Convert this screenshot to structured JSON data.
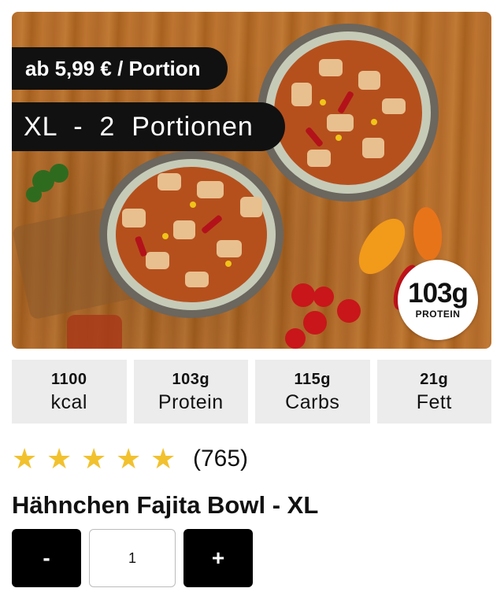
{
  "product": {
    "price_label": "ab 5,99 € / Portion",
    "size_label": "XL  -  2  Portionen",
    "protein_badge": {
      "value": "103g",
      "label": "PROTEIN"
    },
    "title": "Hähnchen Fajita Bowl - XL"
  },
  "nutrition": [
    {
      "value": "1100",
      "label": "kcal"
    },
    {
      "value": "103g",
      "label": "Protein"
    },
    {
      "value": "115g",
      "label": "Carbs"
    },
    {
      "value": "21g",
      "label": "Fett"
    }
  ],
  "rating": {
    "stars": 5,
    "count": "(765)"
  },
  "quantity": {
    "value": "1",
    "minus_label": "-",
    "plus_label": "+"
  },
  "colors": {
    "star": "#f2c12e",
    "button": "#000000",
    "nutrition_bg": "#ececec"
  }
}
